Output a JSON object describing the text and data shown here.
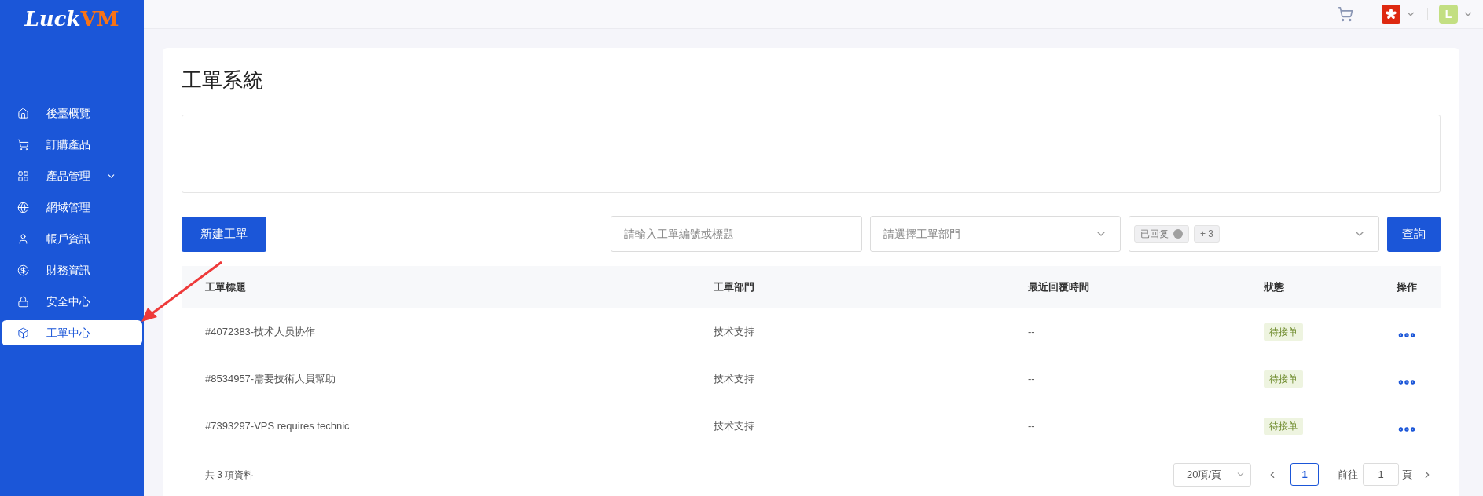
{
  "logo": {
    "part_1": "Luck",
    "part_2": "VM"
  },
  "sidebar": {
    "items": [
      {
        "label": "後臺概覽",
        "selected": false,
        "expandable": false
      },
      {
        "label": "訂購產品",
        "selected": false,
        "expandable": false
      },
      {
        "label": "產品管理",
        "selected": false,
        "expandable": true
      },
      {
        "label": "網域管理",
        "selected": false,
        "expandable": false
      },
      {
        "label": "帳戶資訊",
        "selected": false,
        "expandable": false
      },
      {
        "label": "財務資訊",
        "selected": false,
        "expandable": false
      },
      {
        "label": "安全中心",
        "selected": false,
        "expandable": false
      },
      {
        "label": "工單中心",
        "selected": true,
        "expandable": false
      }
    ]
  },
  "topbar": {
    "avatar": "L"
  },
  "page": {
    "title": "工單系統"
  },
  "toolbar": {
    "new_button": "新建工單",
    "search": {
      "placeholder": "請輸入工單編號或標題"
    },
    "department": {
      "placeholder": "請選擇工單部門"
    },
    "status_tags": [
      "已回复",
      "+ 3"
    ],
    "query_button": "查詢"
  },
  "table": {
    "columns": [
      "工單標題",
      "工單部門",
      "最近回覆時間",
      "狀態",
      "操作"
    ],
    "rows": [
      {
        "title": "#4072383-技术人员协作",
        "department": "技术支持",
        "last_reply": "--",
        "status": "待接单"
      },
      {
        "title": "#8534957-需要技術人員幫助",
        "department": "技术支持",
        "last_reply": "--",
        "status": "待接单"
      },
      {
        "title": "#7393297-VPS requires technic",
        "department": "技术支持",
        "last_reply": "--",
        "status": "待接单"
      }
    ]
  },
  "footer": {
    "total": "共 3 項資料",
    "page_size": "20項/頁",
    "pages": [
      {
        "label": "1",
        "selected": true
      }
    ],
    "goto_label": "前往",
    "goto_value": "1",
    "goto_suffix": "頁"
  }
}
